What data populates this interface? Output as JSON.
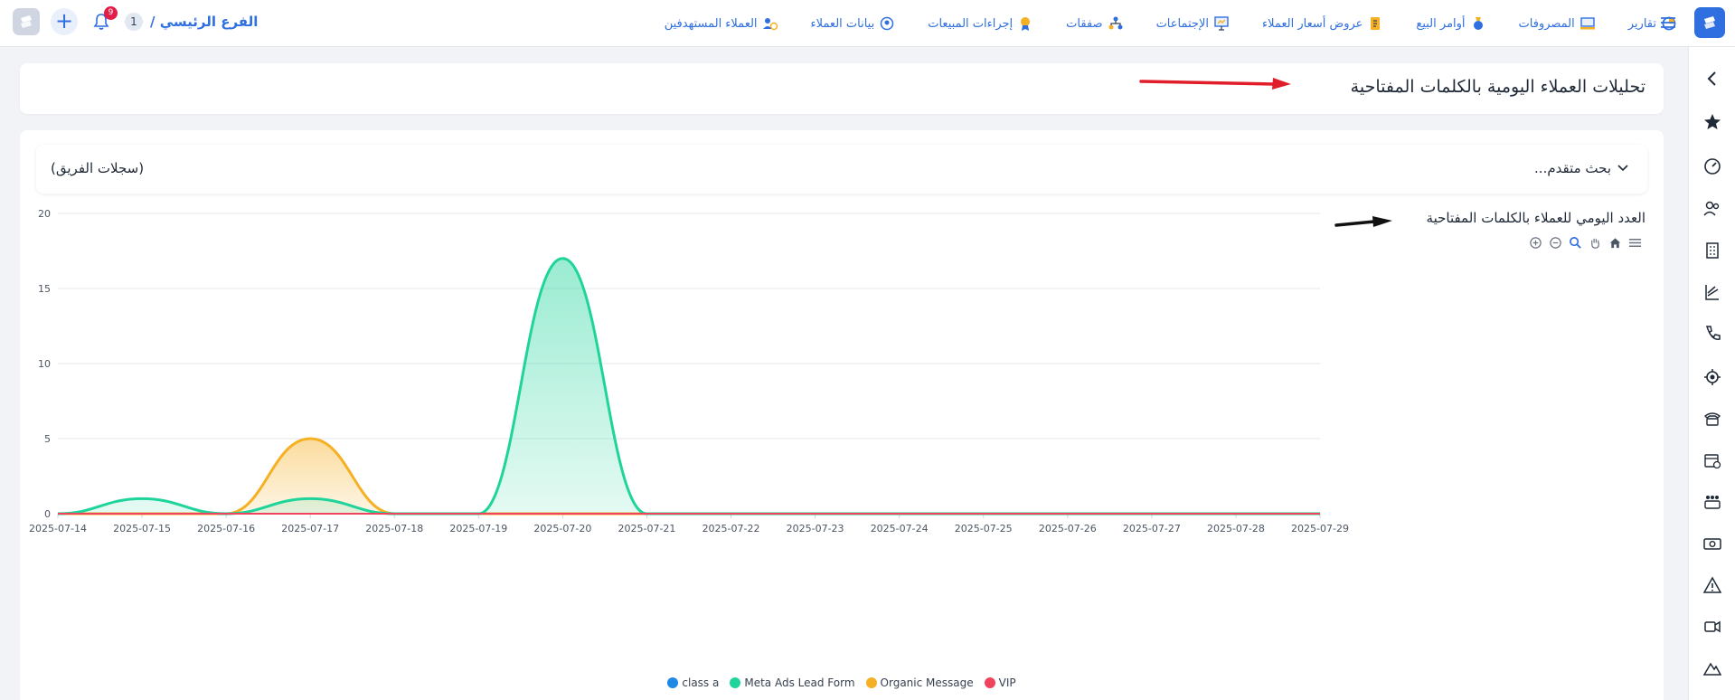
{
  "topbar": {
    "branch_label": "الفرع الرئيسي /",
    "branch_number": "1",
    "notification_count": "9",
    "nav": [
      {
        "label": "العملاء المستهدفين",
        "icon": "target-customers-icon"
      },
      {
        "label": "بيانات العملاء",
        "icon": "customer-data-icon"
      },
      {
        "label": "إجراءات المبيعات",
        "icon": "sales-actions-icon"
      },
      {
        "label": "صفقات",
        "icon": "deals-icon"
      },
      {
        "label": "الإجتماعات",
        "icon": "meetings-icon"
      },
      {
        "label": "عروض أسعار العملاء",
        "icon": "quotes-icon"
      },
      {
        "label": "أوامر البيع",
        "icon": "sales-orders-icon"
      },
      {
        "label": "المصروفات",
        "icon": "expenses-icon"
      },
      {
        "label": "تقارير",
        "icon": "reports-icon"
      }
    ]
  },
  "page": {
    "title": "تحليلات العملاء اليومية بالكلمات المفتاحية"
  },
  "filters": {
    "advanced_search": "بحث متقدم...",
    "team_records": "(سجلات الفريق)"
  },
  "colors": {
    "accent": "#2f6fe0",
    "class_a": "#1e88e5",
    "meta": "#1fd49a",
    "organic": "#f5b024",
    "vip": "#f0435e"
  },
  "chart_data": {
    "type": "area",
    "title": "العدد اليومي للعملاء بالكلمات المفتاحية",
    "x": [
      "2025-07-14",
      "2025-07-15",
      "2025-07-16",
      "2025-07-17",
      "2025-07-18",
      "2025-07-19",
      "2025-07-20",
      "2025-07-21",
      "2025-07-22",
      "2025-07-23",
      "2025-07-24",
      "2025-07-25",
      "2025-07-26",
      "2025-07-27",
      "2025-07-28",
      "2025-07-29"
    ],
    "ylim": [
      0,
      20
    ],
    "yticks": [
      "0",
      "5",
      "10",
      "15",
      "20"
    ],
    "legend_position": "bottom",
    "series": [
      {
        "name": "class a",
        "color": "#1e88e5",
        "values": [
          0,
          0,
          0,
          0,
          0,
          0,
          0,
          0,
          0,
          0,
          0,
          0,
          0,
          0,
          0,
          0
        ]
      },
      {
        "name": "Meta Ads Lead Form",
        "color": "#1fd49a",
        "values": [
          0,
          1,
          0,
          1,
          0,
          0,
          17,
          0,
          0,
          0,
          0,
          0,
          0,
          0,
          0,
          0
        ]
      },
      {
        "name": "Organic Message",
        "color": "#f5b024",
        "values": [
          0,
          0,
          0,
          5,
          0,
          0,
          0,
          0,
          0,
          0,
          0,
          0,
          0,
          0,
          0,
          0
        ]
      },
      {
        "name": "VIP",
        "color": "#f0435e",
        "values": [
          0,
          0,
          0,
          0,
          0,
          0,
          0,
          0,
          0,
          0,
          0,
          0,
          0,
          0,
          0,
          0
        ]
      }
    ]
  }
}
